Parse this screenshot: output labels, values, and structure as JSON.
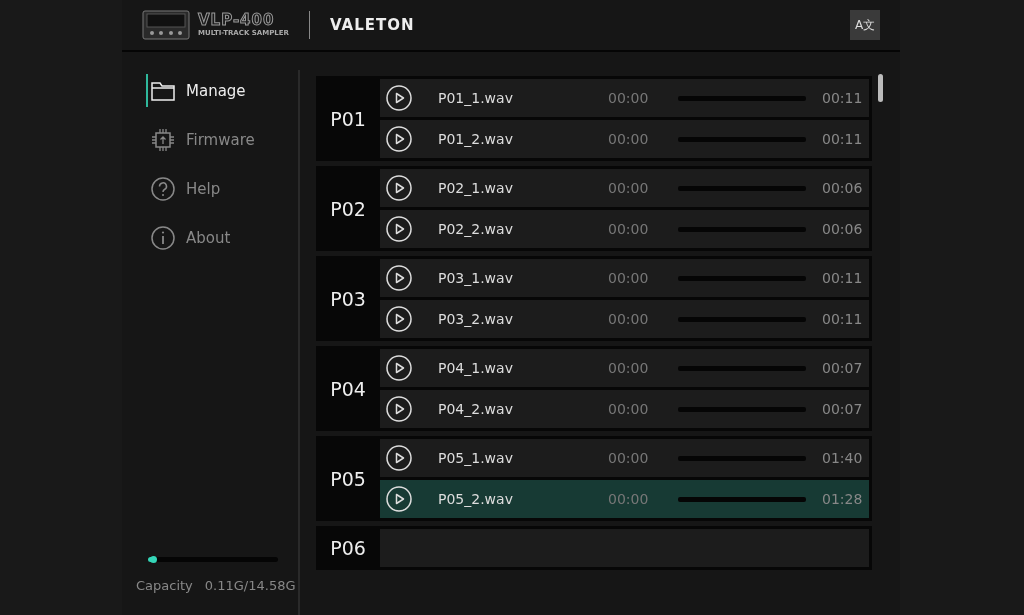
{
  "header": {
    "model": "VLP-400",
    "subtitle": "MULTI-TRACK SAMPLER",
    "brand": "VALETON",
    "language_button": "A文"
  },
  "sidebar": {
    "items": [
      {
        "label": "Manage",
        "selected": true
      },
      {
        "label": "Firmware",
        "selected": false
      },
      {
        "label": "Help",
        "selected": false
      },
      {
        "label": "About",
        "selected": false
      }
    ],
    "capacity": {
      "level": 0.01,
      "label": "Capacity",
      "value": "0.11G/14.58G"
    }
  },
  "presets": [
    {
      "name": "P01",
      "tracks": [
        {
          "file": "P01_1.wav",
          "position": "00:00",
          "duration": "00:11",
          "selected": false
        },
        {
          "file": "P01_2.wav",
          "position": "00:00",
          "duration": "00:11",
          "selected": false
        }
      ]
    },
    {
      "name": "P02",
      "tracks": [
        {
          "file": "P02_1.wav",
          "position": "00:00",
          "duration": "00:06",
          "selected": false
        },
        {
          "file": "P02_2.wav",
          "position": "00:00",
          "duration": "00:06",
          "selected": false
        }
      ]
    },
    {
      "name": "P03",
      "tracks": [
        {
          "file": "P03_1.wav",
          "position": "00:00",
          "duration": "00:11",
          "selected": false
        },
        {
          "file": "P03_2.wav",
          "position": "00:00",
          "duration": "00:11",
          "selected": false
        }
      ]
    },
    {
      "name": "P04",
      "tracks": [
        {
          "file": "P04_1.wav",
          "position": "00:00",
          "duration": "00:07",
          "selected": false
        },
        {
          "file": "P04_2.wav",
          "position": "00:00",
          "duration": "00:07",
          "selected": false
        }
      ]
    },
    {
      "name": "P05",
      "tracks": [
        {
          "file": "P05_1.wav",
          "position": "00:00",
          "duration": "01:40",
          "selected": false
        },
        {
          "file": "P05_2.wav",
          "position": "00:00",
          "duration": "01:28",
          "selected": true
        }
      ]
    },
    {
      "name": "P06"
    }
  ]
}
